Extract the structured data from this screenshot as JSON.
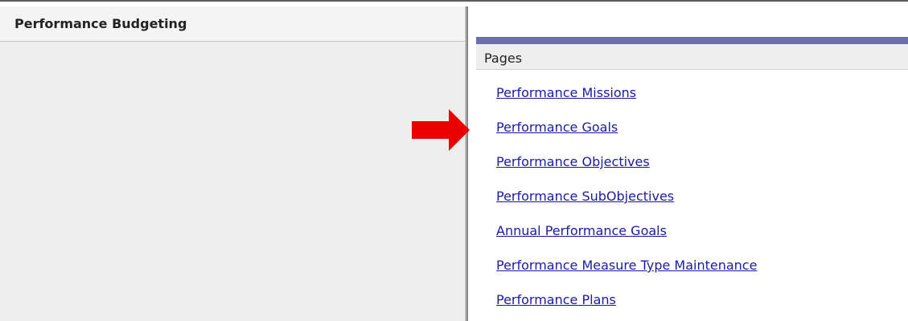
{
  "left_panel": {
    "title": "Performance Budgeting"
  },
  "pages_panel": {
    "header": "Pages",
    "links": [
      "Performance Missions",
      "Performance Goals",
      "Performance Objectives",
      "Performance SubObjectives",
      "Annual Performance Goals",
      "Performance Measure Type Maintenance",
      "Performance Plans"
    ]
  },
  "annotation": {
    "icon": "red-arrow-icon",
    "color": "#ee0000",
    "points_to": "Performance Goals"
  },
  "colors": {
    "link": "#1a1aa8",
    "header_bar": "#6c6ea8",
    "left_background": "#eeeeee"
  }
}
